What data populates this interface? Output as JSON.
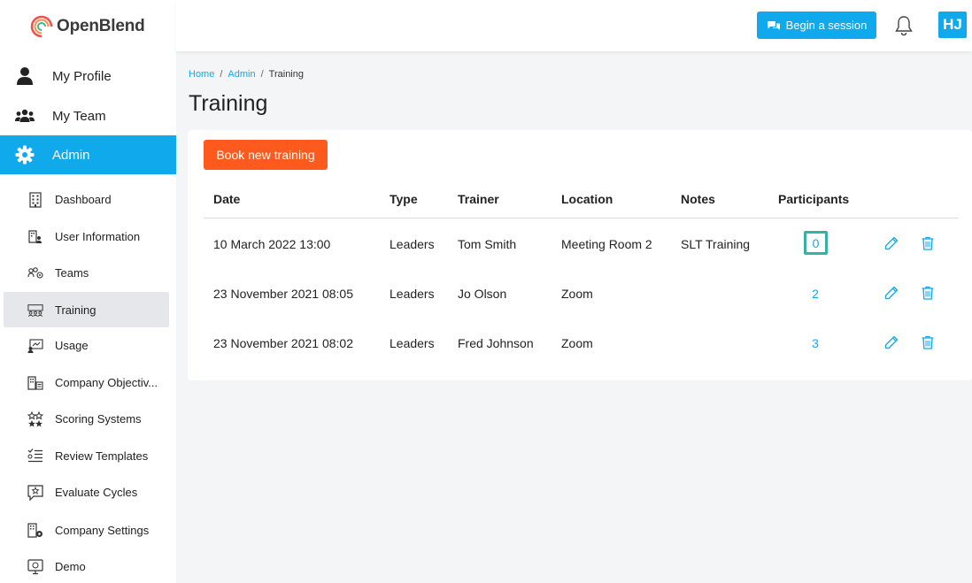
{
  "brand": {
    "name": "OpenBlend"
  },
  "nav": {
    "top": [
      {
        "label": "My Profile",
        "icon": "user-icon"
      },
      {
        "label": "My Team",
        "icon": "users-icon"
      },
      {
        "label": "Admin",
        "icon": "gear-icon"
      }
    ],
    "sub": [
      {
        "label": "Dashboard",
        "icon": "building-icon"
      },
      {
        "label": "User Information",
        "icon": "user-info-icon"
      },
      {
        "label": "Teams",
        "icon": "teams-icon"
      },
      {
        "label": "Training",
        "icon": "training-icon"
      },
      {
        "label": "Usage",
        "icon": "usage-icon"
      },
      {
        "label": "Company Objectiv...",
        "icon": "objectives-icon"
      },
      {
        "label": "Scoring Systems",
        "icon": "stars-icon"
      },
      {
        "label": "Review Templates",
        "icon": "template-icon"
      },
      {
        "label": "Evaluate Cycles",
        "icon": "evaluate-icon"
      },
      {
        "label": "Company Settings",
        "icon": "company-settings-icon"
      },
      {
        "label": "Demo",
        "icon": "monitor-icon"
      }
    ]
  },
  "header": {
    "session_label": "Begin a session",
    "avatar_initials": "HJ"
  },
  "breadcrumb": {
    "home": "Home",
    "admin": "Admin",
    "current": "Training"
  },
  "page": {
    "title": "Training",
    "book_label": "Book new training"
  },
  "table": {
    "columns": [
      "Date",
      "Type",
      "Trainer",
      "Location",
      "Notes",
      "Participants"
    ],
    "rows": [
      {
        "date": "10 March 2022 13:00",
        "type": "Leaders",
        "trainer": "Tom Smith",
        "location": "Meeting Room 2",
        "notes": "SLT Training",
        "participants": "0"
      },
      {
        "date": "23 November 2021 08:05",
        "type": "Leaders",
        "trainer": "Jo Olson",
        "location": "Zoom",
        "notes": "",
        "participants": "2"
      },
      {
        "date": "23 November 2021 08:02",
        "type": "Leaders",
        "trainer": "Fred Johnson",
        "location": "Zoom",
        "notes": "",
        "participants": "3"
      }
    ]
  },
  "colors": {
    "accent": "#10a9ec",
    "orange": "#fe5a1d",
    "focus": "#36b1a4"
  }
}
